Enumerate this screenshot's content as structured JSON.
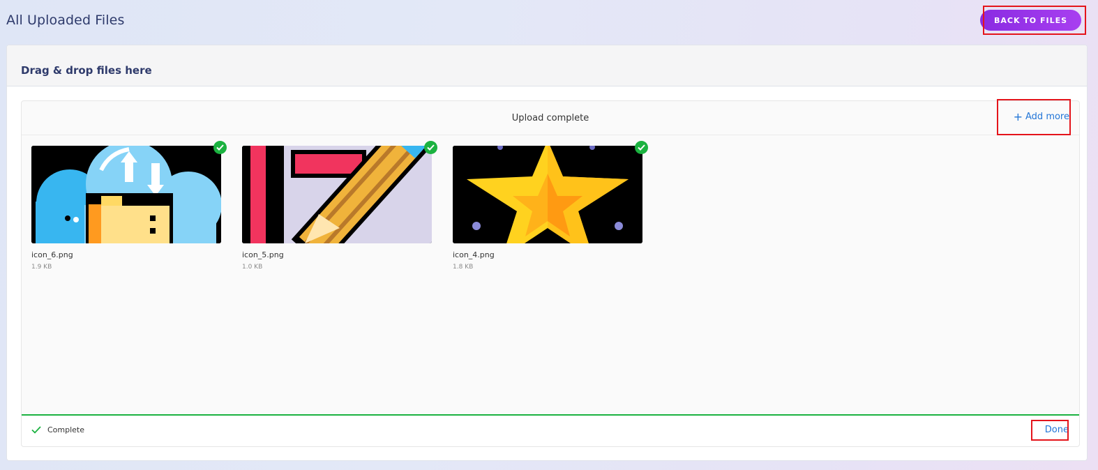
{
  "header": {
    "title": "All Uploaded Files",
    "back_button_label": "BACK TO FILES"
  },
  "card": {
    "title": "Drag & drop files here"
  },
  "uploader": {
    "status_text": "Upload complete",
    "add_more_label": "Add more",
    "files": [
      {
        "name": "icon_6.png",
        "size": "1.9 KB",
        "thumbnail": "cloud-folder-upload-icon",
        "uploaded": true
      },
      {
        "name": "icon_5.png",
        "size": "1.0 KB",
        "thumbnail": "pencil-edit-icon",
        "uploaded": true
      },
      {
        "name": "icon_4.png",
        "size": "1.8 KB",
        "thumbnail": "star-icon",
        "uploaded": true
      }
    ],
    "footer_status": "Complete",
    "done_label": "Done"
  },
  "colors": {
    "accent_purple": "#9a36ea",
    "success_green": "#1bb240",
    "link_blue": "#2275d7",
    "highlight_red": "#e4141b"
  }
}
